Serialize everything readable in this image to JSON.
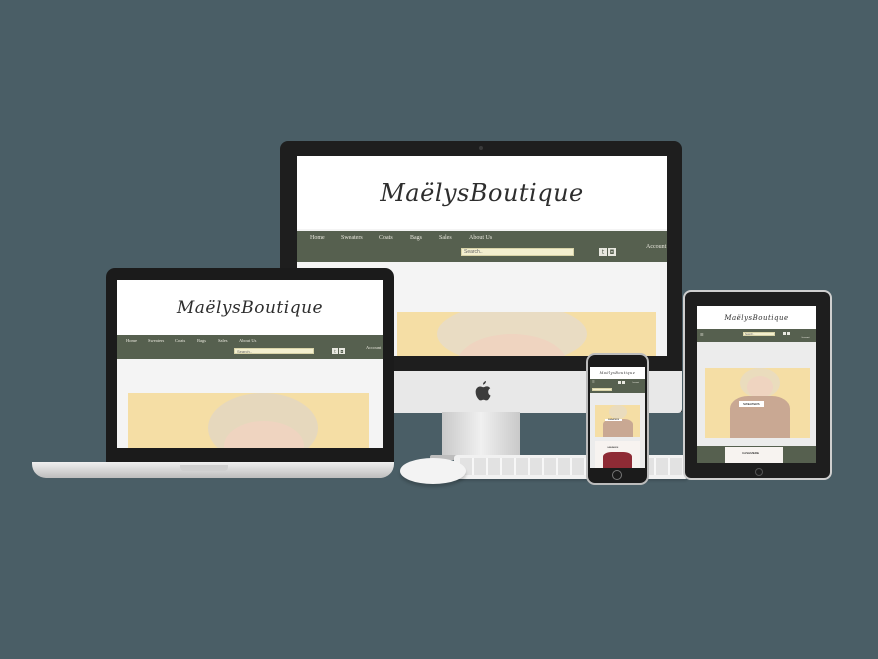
{
  "brand": {
    "logo": "MaëlysBoutique"
  },
  "nav": {
    "items": [
      "Home",
      "Sweaters",
      "Coats",
      "Bags",
      "Sales",
      "About Us"
    ],
    "search_placeholder": "Search..",
    "account": "Account"
  },
  "cards": {
    "sweaters": "SWEATERS",
    "cashmere": "CASHMERE"
  },
  "icons": {
    "twitter": "twitter-icon",
    "instagram": "instagram-icon",
    "apple": "apple-logo-icon",
    "menu": "hamburger-menu-icon"
  },
  "colors": {
    "background": "#4a5e66",
    "nav": "#56604f",
    "search": "#f3efcf",
    "hero": "#f5dea5"
  }
}
